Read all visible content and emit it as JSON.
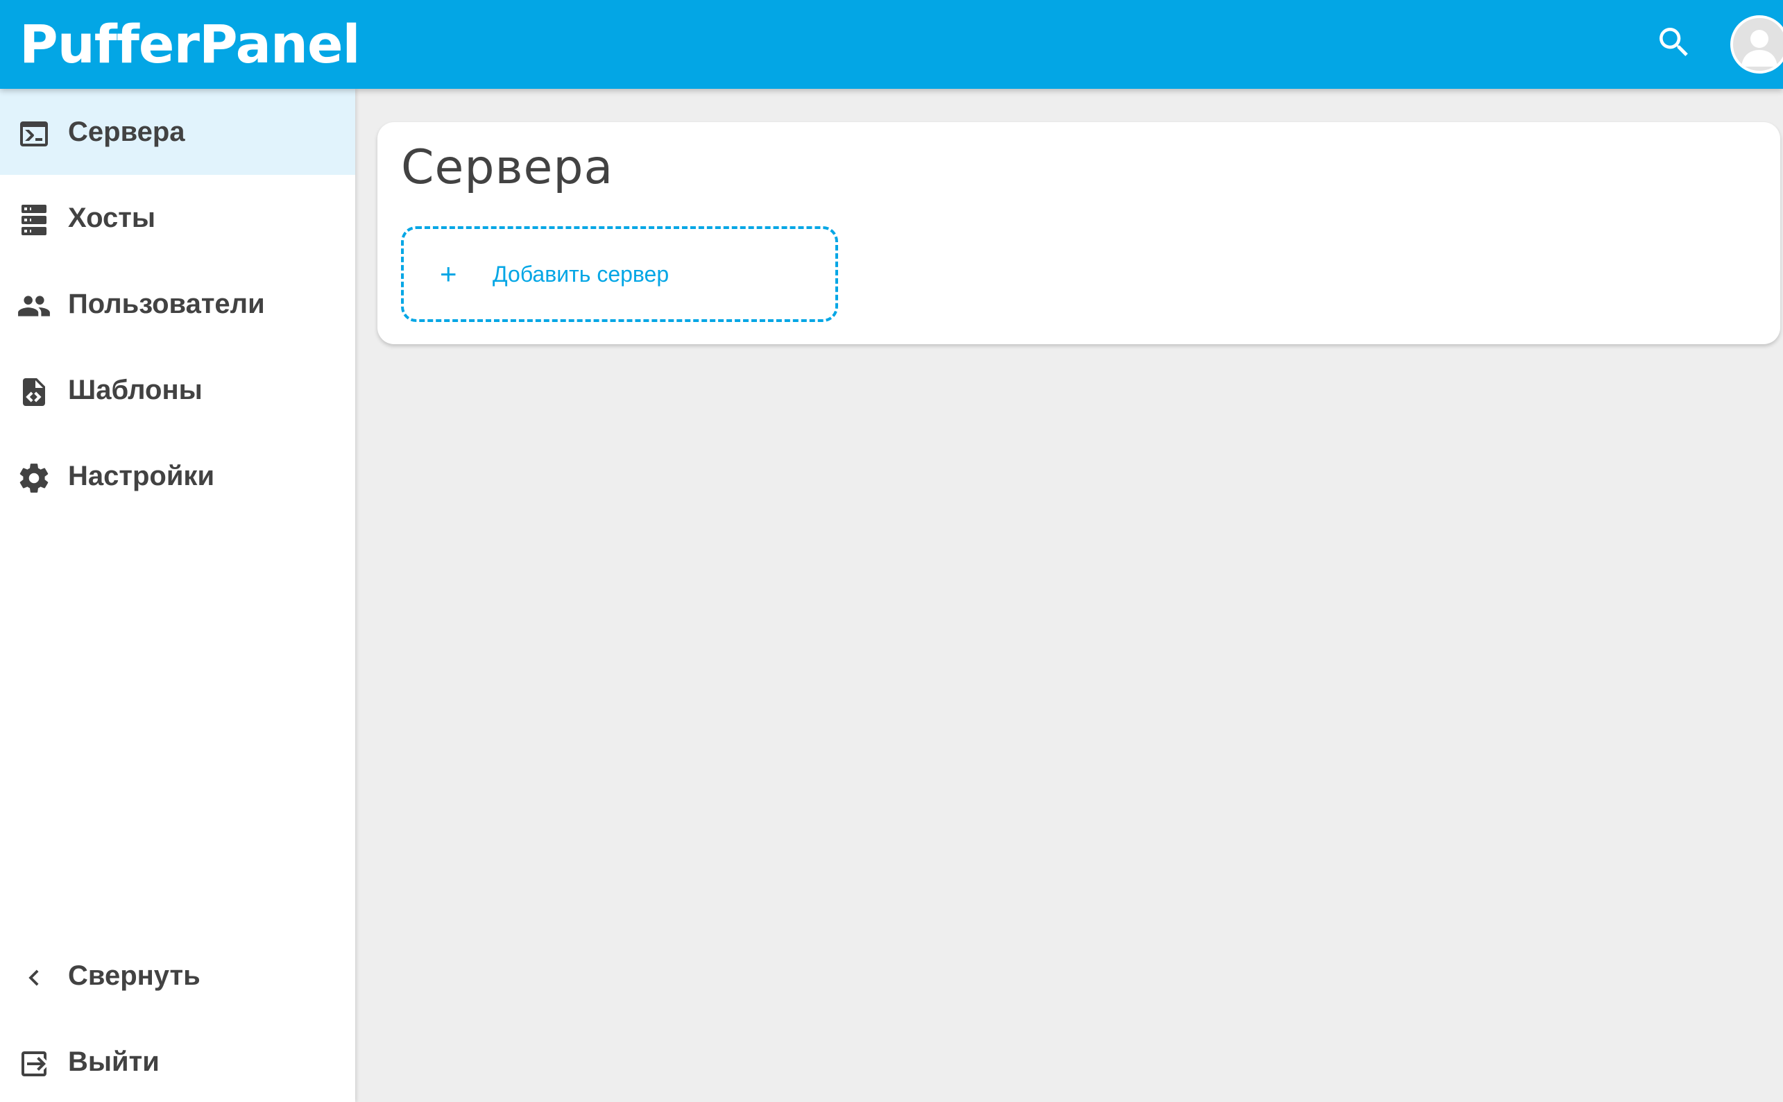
{
  "header": {
    "brand": "PufferPanel",
    "search_icon": "search-icon",
    "avatar_icon": "account-circle-icon"
  },
  "sidebar": {
    "items": [
      {
        "label": "Сервера",
        "icon": "console-icon",
        "active": true
      },
      {
        "label": "Хосты",
        "icon": "server-stack-icon",
        "active": false
      },
      {
        "label": "Пользователи",
        "icon": "account-group-icon",
        "active": false
      },
      {
        "label": "Шаблоны",
        "icon": "file-code-icon",
        "active": false
      },
      {
        "label": "Настройки",
        "icon": "gear-icon",
        "active": false
      }
    ],
    "footer": [
      {
        "label": "Свернуть",
        "icon": "chevron-left-icon"
      },
      {
        "label": "Выйти",
        "icon": "logout-icon"
      }
    ]
  },
  "main": {
    "title": "Сервера",
    "add_server": {
      "plus": "+",
      "label": "Добавить сервер"
    }
  },
  "colors": {
    "primary": "#03a6e5",
    "active_item_bg": "#e1f3fc",
    "text": "#424242",
    "background": "#eeeeee"
  }
}
